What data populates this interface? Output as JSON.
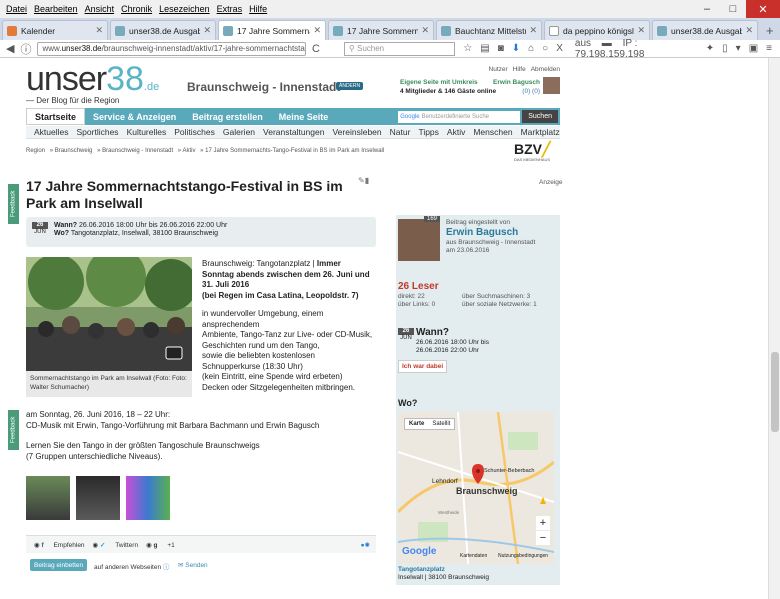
{
  "menubar": [
    "Datei",
    "Bearbeiten",
    "Ansicht",
    "Chronik",
    "Lesezeichen",
    "Extras",
    "Hilfe"
  ],
  "window_controls": {
    "minimize": "–",
    "maximize": "□",
    "close": "✕"
  },
  "tabs": [
    {
      "label": "Kalender"
    },
    {
      "label": "unser38.de Ausgaben..."
    },
    {
      "label": "17 Jahre Sommernac..."
    },
    {
      "label": "17 Jahre Sommernac..."
    },
    {
      "label": "Bauchtanz Mittelstuf..."
    },
    {
      "label": "da peppino königslut..."
    },
    {
      "label": "unser38.de Ausgaben..."
    }
  ],
  "tab_close": "✕",
  "new_tab": "+",
  "browser": {
    "url_prefix": "www.",
    "url_domain": "unser38.de",
    "url_path": "/braunschweig-innenstadt/aktiv/17-jahre-sommernachtstango-festi",
    "reload": "C",
    "search_placeholder": "Suchen",
    "ip_prefix": "aus",
    "ip": "IP : 79.198.159.198"
  },
  "site": {
    "logo_main": "unser",
    "logo_num": "38",
    "logo_tld": ".de",
    "tagline": "— Der Blog für die Region",
    "city": "Braunschweig - Innenstadt",
    "city_badge": "ÄNDERN",
    "top_links": [
      "Nutzer",
      "Hilfe",
      "Abmelden"
    ],
    "own_page": "Eigene Seite mit Umkreis",
    "user_name": "Erwin Bagusch",
    "members_online": "4 Mitglieder & 146 Gäste online",
    "user_counts": "(0) (0)"
  },
  "mainnav": [
    "Startseite",
    "Service & Anzeigen",
    "Beitrag erstellen",
    "Meine Seite"
  ],
  "google_placeholder": "Benutzerdefinierte Suche",
  "search_button": "Suchen",
  "subnav": [
    "Aktuelles",
    "Sportliches",
    "Kulturelles",
    "Politisches",
    "Galerien",
    "Veranstaltungen",
    "Vereinsleben",
    "Natur",
    "Tipps",
    "Aktiv",
    "Menschen",
    "Marktplatz"
  ],
  "breadcrumb": [
    "Region",
    "» Braunschweig",
    "» Braunschweig - Innenstadt",
    "» Aktiv",
    "» 17 Jahre Sommernachts-Tango-Festival in BS im Park am Inselwall"
  ],
  "bzv": {
    "logo": "BZV",
    "sub": "DAS MEDIENHAUS"
  },
  "article": {
    "title": "17 Jahre Sommernachtstango-Festival in BS im Park am Inselwall",
    "anzeige": "Anzeige",
    "date_day": "26",
    "date_month": "JUN",
    "wann_label": "Wann?",
    "wann_value": "26.06.2016 18:00 Uhr bis 26.06.2016 22:00 Uhr",
    "wo_label": "Wo?",
    "wo_value": "Tangotanzplatz, Inselwall, 38100 Braunschweig",
    "photo_caption": "Sommernachtstango im Park am Inselwall (Foto: Foto: Walter Schumacher)",
    "p1_lead": "Braunschweig: Tangotanzplatz | ",
    "p1_bold": "Immer Sonntag abends zwischen dem 26. Juni und 31. Juli 2016",
    "p1_bold2": "(bei Regen im Casa Latina, Leopoldstr. 7)",
    "p2": "in wundervoller Umgebung, einem ansprechendem",
    "p3": "Ambiente, Tango-Tanz zur Live- oder CD-Musik,",
    "p4": "Geschichten rund um den Tango,",
    "p5": "sowie die beliebten kostenlosen Schnupperkurse (18:30 Uhr)",
    "p6": "(kein Eintritt, eine Spende wird erbeten)",
    "p7": "Decken oder Sitzgelegenheiten mitbringen.",
    "p8": "am Sonntag, 26. Juni 2016, 18 – 22 Uhr:",
    "p9": "CD-Musik mit Erwin, Tango-Vorführung mit Barbara Bachmann und Erwin Bagusch",
    "p10": "Lernen Sie den Tango in der größten Tangoschule Braunschweigs",
    "p11": "(7 Gruppen unterschiedliche Niveaus)."
  },
  "share": {
    "empfehlen": "Empfehlen",
    "twittern": "Twittern",
    "plus": "+1",
    "embed_button": "Beitrag einbetten",
    "embed_text": "auf anderen Webseiten",
    "senden": "Senden"
  },
  "feedback": "Feedback",
  "sidebar": {
    "count": "169",
    "posted_by": "Beitrag eingestellt von",
    "author": "Erwin Bagusch",
    "author_from": "aus Braunschweig - Innenstadt",
    "author_date": "am 23.06.2016",
    "leser": "26 Leser",
    "direkt": "direkt: 22",
    "links": "über Links: 0",
    "suchmaschinen": "über Suchmaschinen: 3",
    "sozial": "über soziale Netzwerke: 1",
    "date_day": "26",
    "date_month": "JUN",
    "wann": "Wann?",
    "wann_from": "26.06.2016 18:00 Uhr bis",
    "wann_to": "26.06.2016 22:00 Uhr",
    "dabei": "Ich war dabei",
    "wo": "Wo?",
    "map_tabs": [
      "Karte",
      "Satellit"
    ],
    "map_labels": [
      "Lehndorf",
      "Braunschweig",
      "Schunter-Beberbach",
      "Westheide"
    ],
    "map_google": "Google",
    "map_footer": [
      "Kartendaten",
      "Nutzungsbedingungen"
    ],
    "place_name": "Tangotanzplatz",
    "place_addr": "Inselwall | 38100 Braunschweig"
  },
  "colors": {
    "accent": "#5aa9bb",
    "link": "#2a7a9a",
    "red": "#c0392b",
    "green": "#3a8a5a"
  }
}
